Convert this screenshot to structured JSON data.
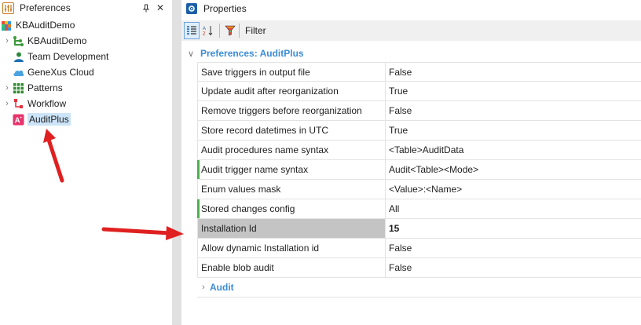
{
  "left_panel": {
    "title": "Preferences",
    "pin_symbol": "⍕",
    "close_symbol": "✕",
    "tree": [
      {
        "label": "KBAuditDemo",
        "icon": "kb-cube-icon",
        "expandable": false,
        "indent": 0
      },
      {
        "label": "KBAuditDemo",
        "icon": "environment-icon",
        "expandable": true,
        "indent": 1
      },
      {
        "label": "Team Development",
        "icon": "team-development-icon",
        "expandable": false,
        "indent": 1
      },
      {
        "label": "GeneXus Cloud",
        "icon": "cloud-icon",
        "expandable": false,
        "indent": 1
      },
      {
        "label": "Patterns",
        "icon": "patterns-grid-icon",
        "expandable": true,
        "indent": 1
      },
      {
        "label": "Workflow",
        "icon": "workflow-icon",
        "expandable": true,
        "indent": 1
      },
      {
        "label": "AuditPlus",
        "icon": "auditplus-icon",
        "expandable": false,
        "indent": 1,
        "selected": true
      }
    ]
  },
  "right_panel": {
    "title": "Properties",
    "toolbar": {
      "categorized_icon": "categorized-view-icon",
      "alphabetical_icon": "alphabetical-sort-icon",
      "filter_icon": "filter-icon",
      "filter_label": "Filter"
    },
    "category": {
      "label": "Preferences: AuditPlus",
      "chevron": "∨"
    },
    "properties": [
      {
        "name": "Save triggers in output file",
        "value": "False"
      },
      {
        "name": "Update audit after reorganization",
        "value": "True"
      },
      {
        "name": "Remove triggers before reorganization",
        "value": "False"
      },
      {
        "name": "Store record datetimes in UTC",
        "value": "True"
      },
      {
        "name": "Audit procedures name syntax",
        "value": "<Table>AuditData"
      },
      {
        "name": "Audit trigger name syntax",
        "value": "Audit<Table><Mode>",
        "modified": true
      },
      {
        "name": "Enum values mask",
        "value": "<Value>:<Name>"
      },
      {
        "name": "Stored changes config",
        "value": "All",
        "modified": true
      },
      {
        "name": "Installation Id",
        "value": "15",
        "selected": true
      },
      {
        "name": "Allow dynamic Installation id",
        "value": "False"
      },
      {
        "name": "Enable blob audit",
        "value": "False"
      }
    ],
    "subcategory": {
      "label": "Audit",
      "chevron": "›"
    }
  },
  "colors": {
    "accent_blue": "#3b8cd6",
    "selection_blue": "#cce4f7",
    "modified_green": "#4caf50",
    "arrow_red": "#e02020"
  }
}
